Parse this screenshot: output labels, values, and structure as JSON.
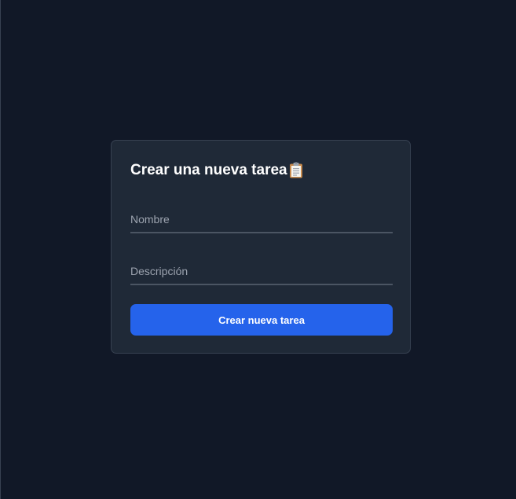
{
  "form": {
    "title": "Crear una nueva tarea",
    "title_icon": "clipboard-icon",
    "name_placeholder": "Nombre",
    "name_value": "",
    "description_placeholder": "Descripción",
    "description_value": "",
    "submit_label": "Crear nueva tarea"
  },
  "colors": {
    "background": "#111827",
    "card": "#1f2937",
    "accent": "#2563eb",
    "field_border": "#4b5563",
    "placeholder": "#9ca3af"
  }
}
